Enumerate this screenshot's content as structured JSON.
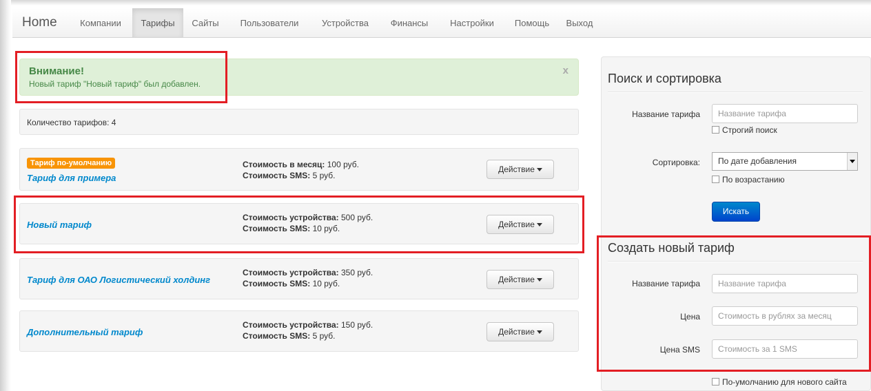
{
  "navbar": {
    "brand": "Home",
    "items": [
      {
        "label": "Компании"
      },
      {
        "label": "Тарифы",
        "active": true
      },
      {
        "label": "Сайты"
      },
      {
        "label": "Пользователи"
      },
      {
        "label": "Устройства"
      },
      {
        "label": "Финансы"
      },
      {
        "label": "Настройки"
      },
      {
        "label": "Помощь"
      },
      {
        "label": "Выход"
      }
    ]
  },
  "alert": {
    "title": "Внимание!",
    "message": "Новый тариф \"Новый тариф\" был добавлен.",
    "close": "x"
  },
  "tariff_count": "Количество тарифов: 4",
  "tariffs": [
    {
      "badge": "Тариф по-умолчанию",
      "name": "Тариф для примера",
      "line1_label": "Стоимость в месяц:",
      "line1_value": " 100 руб.",
      "line2_label": "Стоимость SMS:",
      "line2_value": " 5 руб.",
      "action": "Действие"
    },
    {
      "name": "Новый тариф",
      "line1_label": "Стоимость устройства:",
      "line1_value": " 500 руб.",
      "line2_label": "Стоимость SMS:",
      "line2_value": " 10 руб.",
      "action": "Действие"
    },
    {
      "name": "Тариф для ОАО Логистический холдинг",
      "line1_label": "Стоимость устройства:",
      "line1_value": " 350 руб.",
      "line2_label": "Стоимость SMS:",
      "line2_value": " 10 руб.",
      "action": "Действие"
    },
    {
      "name": "Дополнительный тариф",
      "line1_label": "Стоимость устройства:",
      "line1_value": " 150 руб.",
      "line2_label": "Стоимость SMS:",
      "line2_value": " 5 руб.",
      "action": "Действие"
    }
  ],
  "search": {
    "heading": "Поиск и сортировка",
    "name_label": "Название тарифа",
    "name_placeholder": "Название тарифа",
    "strict_label": "Строгий поиск",
    "sort_label": "Сортировка:",
    "sort_value": "По дате добавления",
    "asc_label": "По возрастанию",
    "button": "Искать"
  },
  "create": {
    "heading": "Создать новый тариф",
    "name_label": "Название тарифа",
    "name_placeholder": "Название тарифа",
    "price_label": "Цена",
    "price_placeholder": "Стоимость в рублях за месяц",
    "sms_label": "Цена SMS",
    "sms_placeholder": "Стоимость за 1 SMS",
    "default_label": "По-умолчанию для нового сайта"
  },
  "colors": {
    "highlight": "#e31e24",
    "link": "#0088cc",
    "badge": "#f89406",
    "alert_bg": "#dff0d8",
    "alert_text": "#468847",
    "primary_button": "#0066cc"
  }
}
